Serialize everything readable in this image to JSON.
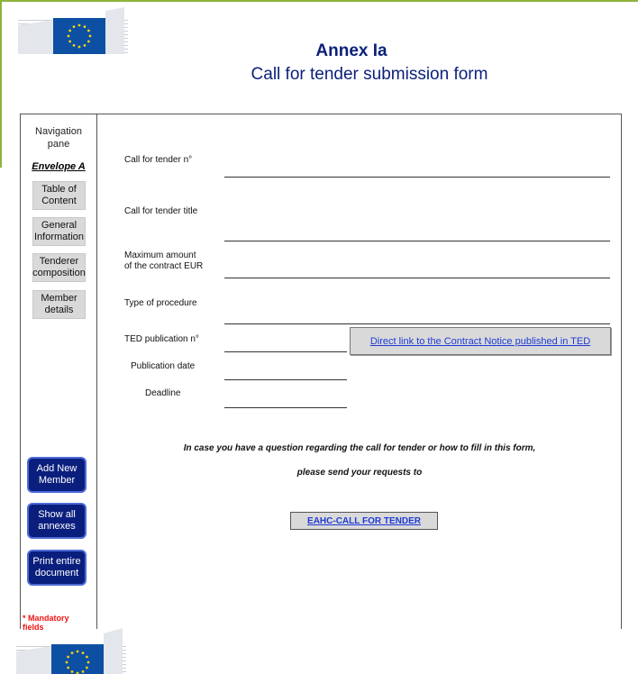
{
  "header": {
    "title": "Annex Ia",
    "subtitle": "Call for tender submission form"
  },
  "nav": {
    "title_line1": "Navigation",
    "title_line2": "pane",
    "envelope": "Envelope A",
    "items": [
      {
        "line1": "Table of",
        "line2": "Content"
      },
      {
        "line1": "General",
        "line2": "Information"
      },
      {
        "line1": "Tenderer",
        "line2": "composition"
      },
      {
        "line1": "Member",
        "line2": "details"
      }
    ],
    "actions": [
      {
        "line1": "Add New",
        "line2": "Member"
      },
      {
        "line1": "Show all",
        "line2": "annexes"
      },
      {
        "line1": "Print entire",
        "line2": "document"
      }
    ],
    "mandatory_line1": "* Mandatory",
    "mandatory_line2": "fields"
  },
  "form": {
    "call_number_label": "Call for tender n°",
    "call_title_label": "Call for tender title",
    "max_amount_label_line1": "Maximum amount",
    "max_amount_label_line2": "of the contract EUR",
    "procedure_label": "Type of procedure",
    "ted_label": "TED publication n°",
    "publication_date_label": "Publication date",
    "deadline_label": "Deadline",
    "ted_link": "Direct link to the Contract Notice published in TED"
  },
  "contact": {
    "question_line1": "In case you have a question regarding the call for tender or how to fill in this form,",
    "question_line2": "please send your requests to",
    "button": "EAHC-CALL FOR TENDER"
  },
  "colors": {
    "accent_green": "#8db33a",
    "title_blue": "#0b1f7a",
    "button_blue": "#0a1f7d",
    "link_blue": "#1f3bd6",
    "mandatory_red": "#e11111"
  }
}
